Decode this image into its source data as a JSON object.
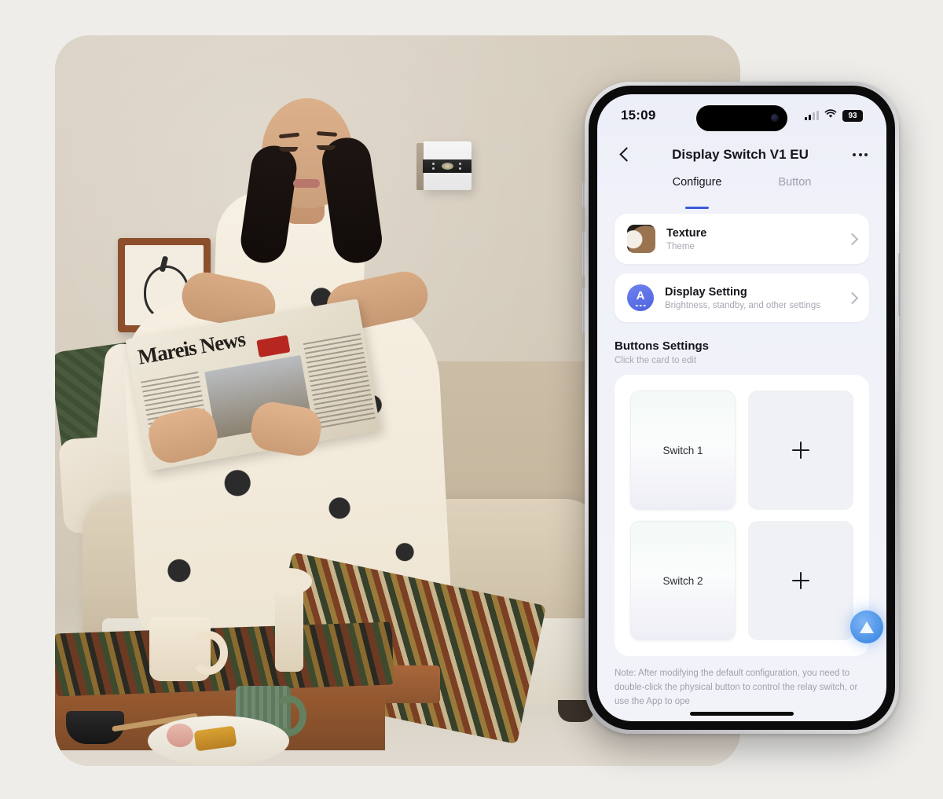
{
  "scene": {
    "photo_alt": "Woman reading a newspaper on a sofa in a living room with a wall-mounted smart display switch",
    "newspaper_title": "Mareis News",
    "wall_device": "display-switch"
  },
  "phone": {
    "status_bar": {
      "time": "15:09",
      "battery_percent": "93",
      "signal_icon": "cellular-signal-icon",
      "wifi_icon": "wifi-icon",
      "battery_icon": "battery-icon"
    },
    "nav": {
      "back_icon": "back-chevron-icon",
      "title": "Display Switch V1 EU",
      "more_icon": "more-options-icon"
    },
    "tabs": [
      {
        "label": "Configure",
        "active": true
      },
      {
        "label": "Button",
        "active": false
      }
    ],
    "cards": [
      {
        "icon": "texture-thumbnail-icon",
        "title": "Texture",
        "subtitle": "Theme",
        "chevron": "chevron-right-icon"
      },
      {
        "icon": "brightness-auto-icon",
        "title": "Display Setting",
        "subtitle": "Brightness, standby, and other settings",
        "chevron": "chevron-right-icon"
      }
    ],
    "buttons_section": {
      "title": "Buttons Settings",
      "subtitle": "Click the card to edit",
      "tiles": [
        {
          "label": "Switch 1",
          "type": "filled"
        },
        {
          "label": "",
          "type": "add",
          "icon": "plus-icon"
        },
        {
          "label": "Switch 2",
          "type": "filled"
        },
        {
          "label": "",
          "type": "add",
          "icon": "plus-icon"
        }
      ],
      "fab_icon": "triangle-play-icon"
    },
    "note": "Note: After modifying the default configuration, you need to double-click the physical button to control the relay switch, or use the App to ope"
  },
  "colors": {
    "page_background": "#eeedea",
    "accent_blue": "#3b5bdb",
    "icon_blue": "#4f63e0",
    "fab_blue": "#2f7fe0",
    "text_primary": "#14151a",
    "text_secondary": "#a6a8b3"
  }
}
